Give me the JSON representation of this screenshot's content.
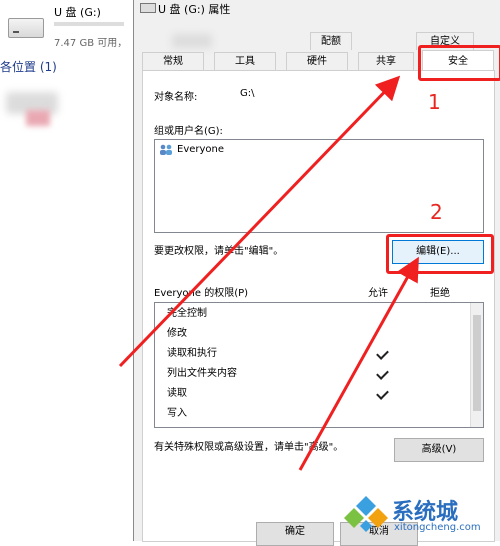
{
  "left": {
    "drive_name": "U 盘 (G:)",
    "drive_free": "7.47 GB 可用，",
    "section_label": "各位置 (1)"
  },
  "dialog": {
    "title": "U 盘 (G:) 属性",
    "tabs_row1": [
      "配额",
      "自定义"
    ],
    "tabs_row2": [
      "常规",
      "工具",
      "硬件",
      "共享",
      "安全"
    ],
    "active_tab": "安全",
    "object_name_label": "对象名称:",
    "object_name_value": "G:\\",
    "groups_label": "组或用户名(G):",
    "groups": [
      "Everyone"
    ],
    "change_hint": "要更改权限，请单击\"编辑\"。",
    "edit_button": "编辑(E)...",
    "perm_label": "Everyone 的权限(P)",
    "col_allow": "允许",
    "col_deny": "拒绝",
    "permissions": [
      {
        "name": "完全控制",
        "allow": false,
        "deny": false
      },
      {
        "name": "修改",
        "allow": false,
        "deny": false
      },
      {
        "name": "读取和执行",
        "allow": true,
        "deny": false
      },
      {
        "name": "列出文件夹内容",
        "allow": true,
        "deny": false
      },
      {
        "name": "读取",
        "allow": true,
        "deny": false
      },
      {
        "name": "写入",
        "allow": false,
        "deny": false
      }
    ],
    "advanced_hint": "有关特殊权限或高级设置，请单击\"高级\"。",
    "advanced_button": "高级(V)",
    "ok_button": "确定",
    "cancel_button": "取消"
  },
  "annotations": {
    "step1": "1",
    "step2": "2",
    "accent_color": "#f02020"
  },
  "watermark": {
    "brand": "系统城",
    "url": "xitongcheng.com"
  }
}
